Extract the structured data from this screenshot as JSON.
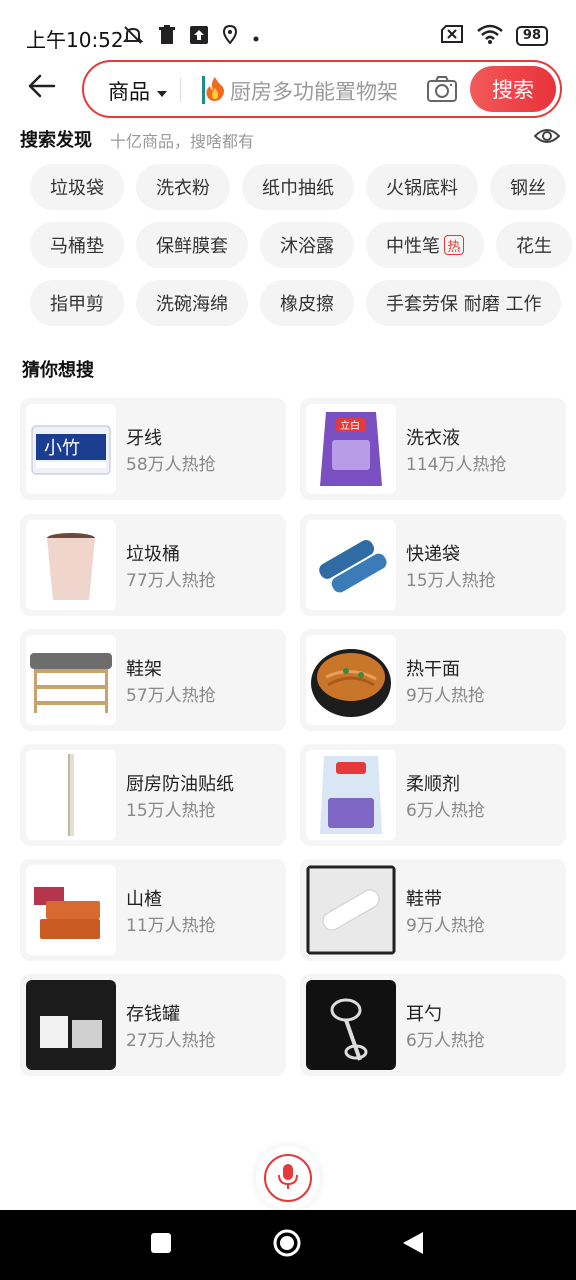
{
  "status": {
    "time": "上午10:52",
    "battery": "98"
  },
  "search": {
    "category": "商品",
    "placeholder": "厨房多功能置物架",
    "button": "搜索"
  },
  "discover": {
    "title": "搜索发现",
    "subtitle": "十亿商品，搜啥都有",
    "rows": [
      [
        {
          "label": "垃圾袋"
        },
        {
          "label": "洗衣粉"
        },
        {
          "label": "纸巾抽纸"
        },
        {
          "label": "火锅底料"
        },
        {
          "label": "钢丝"
        }
      ],
      [
        {
          "label": "马桶垫"
        },
        {
          "label": "保鲜膜套"
        },
        {
          "label": "沐浴露"
        },
        {
          "label": "中性笔",
          "hot": "热"
        },
        {
          "label": "花生"
        }
      ],
      [
        {
          "label": "指甲剪"
        },
        {
          "label": "洗碗海绵"
        },
        {
          "label": "橡皮擦"
        },
        {
          "label": "手套劳保 耐磨 工作"
        }
      ]
    ]
  },
  "guess": {
    "title": "猜你想搜",
    "items": [
      {
        "title": "牙线",
        "hot": "58万人热抢"
      },
      {
        "title": "洗衣液",
        "hot": "114万人热抢"
      },
      {
        "title": "垃圾桶",
        "hot": "77万人热抢"
      },
      {
        "title": "快递袋",
        "hot": "15万人热抢"
      },
      {
        "title": "鞋架",
        "hot": "57万人热抢"
      },
      {
        "title": "热干面",
        "hot": "9万人热抢"
      },
      {
        "title": "厨房防油贴纸",
        "hot": "15万人热抢"
      },
      {
        "title": "柔顺剂",
        "hot": "6万人热抢"
      },
      {
        "title": "山楂",
        "hot": "11万人热抢"
      },
      {
        "title": "鞋带",
        "hot": "9万人热抢"
      },
      {
        "title": "存钱罐",
        "hot": "27万人热抢"
      },
      {
        "title": "耳勺",
        "hot": "6万人热抢"
      }
    ]
  },
  "colors": {
    "accent": "#e53a3a"
  }
}
